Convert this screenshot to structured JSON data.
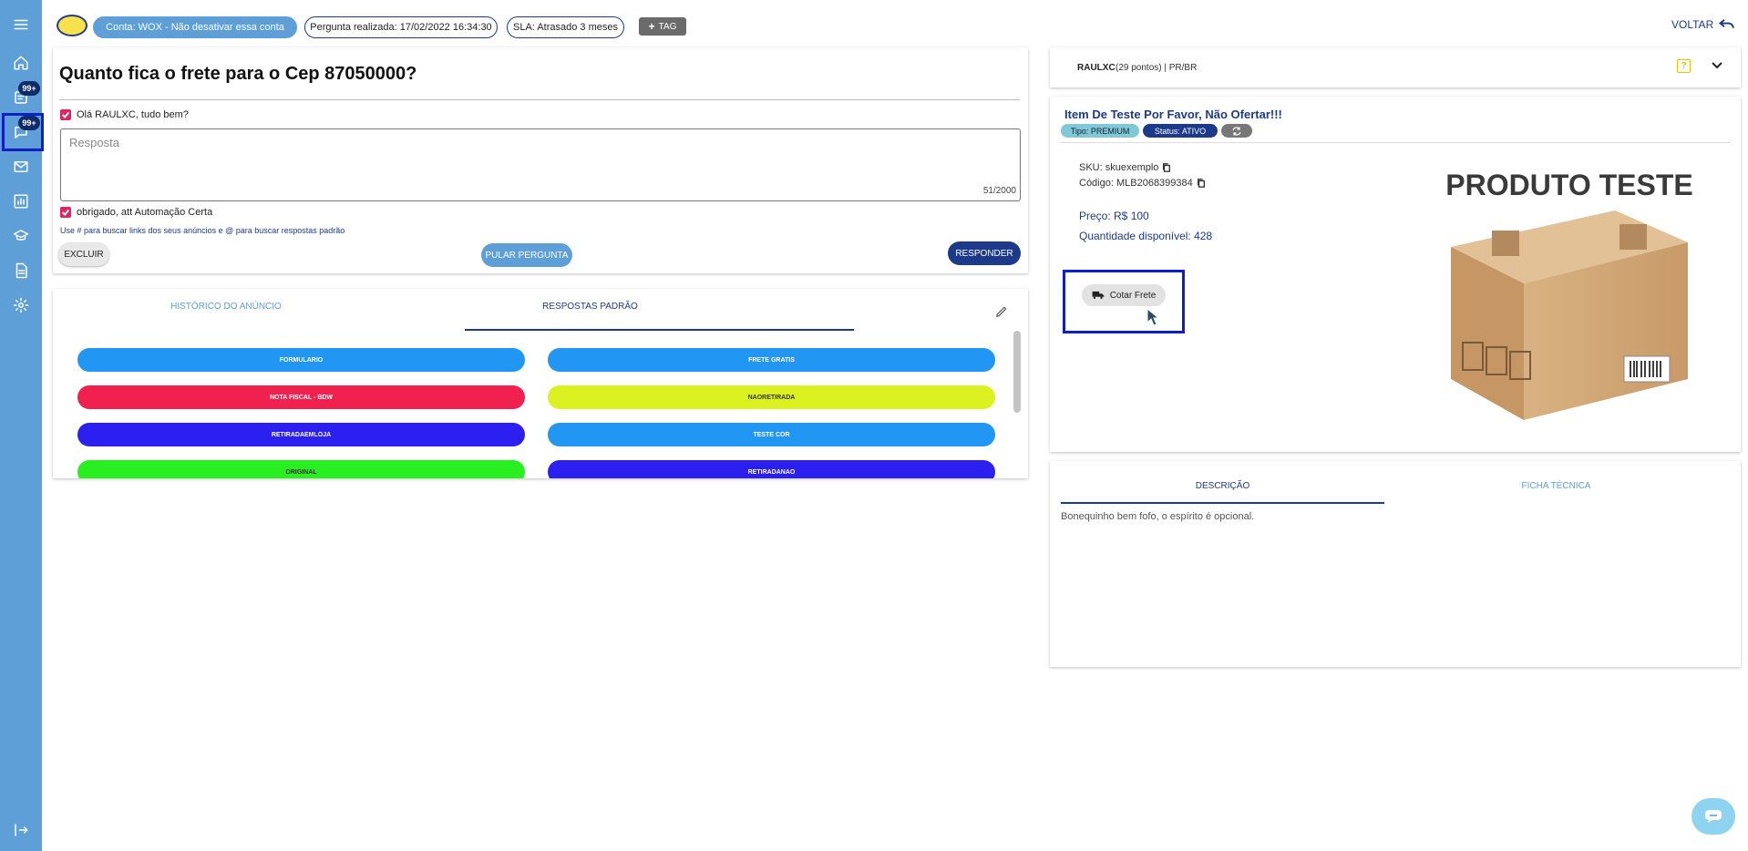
{
  "topbar": {
    "account_pill": "Conta: WOX - Não desativar essa conta",
    "question_date_pill": "Pergunta realizada: 17/02/2022 16:34:30",
    "sla_pill": "SLA: Atrasado 3 meses",
    "tag_label": "TAG",
    "back_label": "VOLTAR"
  },
  "sidebar": {
    "badges": [
      "99+",
      "99+"
    ]
  },
  "question": {
    "title": "Quanto fica o frete para o Cep 87050000?",
    "greeting": "Olá RAULXC, tudo bem?",
    "answer_placeholder": "Resposta",
    "char_counter": "51/2000",
    "signature": "obrigado, att Automação Certa",
    "hint": "Use # para buscar links dos seus anúncios e @ para buscar respostas padrão",
    "delete_label": "EXCLUIR",
    "skip_label": "PULAR PERGUNTA",
    "reply_label": "RESPONDER"
  },
  "answers_panel": {
    "tabs": [
      "HISTÓRICO DO ANÚNCIO",
      "RESPOSTAS PADRÃO"
    ],
    "buttons": [
      {
        "label": "FORMULARIO",
        "color": "#2196f3"
      },
      {
        "label": "FRETE GRATIS",
        "color": "#2196f3"
      },
      {
        "label": "NOTA FISCAL - BDW",
        "color": "#f0204f"
      },
      {
        "label": "NAORETIRADA",
        "color": "#dcf220"
      },
      {
        "label": "RETIRADAEMLOJA",
        "color": "#2c20f0"
      },
      {
        "label": "TESTE COR",
        "color": "#2196f3"
      },
      {
        "label": "ORIGINAL",
        "color": "#28f020"
      },
      {
        "label": "RETIRADANAO",
        "color": "#2c20f0"
      }
    ]
  },
  "buyer": {
    "name": "RAULXC",
    "details": "(29 pontos) | PR/BR"
  },
  "item": {
    "title": "Item De Teste Por Favor, Não Ofertar!!!",
    "type_badge": "Tipo: PREMIUM",
    "status_badge": "Status: ATIVO",
    "sku": "SKU: skuexemplo",
    "code": "Código: MLB2068399384",
    "price": "Preço: R$ 100",
    "quantity": "Quantidade disponível: 428",
    "quote_shipping_label": "Cotar Frete",
    "image_caption": "PRODUTO TESTE"
  },
  "description_panel": {
    "tabs": [
      "DESCRIÇÃO",
      "FICHA TÉCNICA"
    ],
    "text": "Bonequinho bem fofo, o espírito é opcional."
  },
  "colors": {
    "sidebar": "#5e9fd8",
    "primary": "#1d3a8a",
    "highlight": "#0f1fc7",
    "checkbox": "#e0245e"
  }
}
